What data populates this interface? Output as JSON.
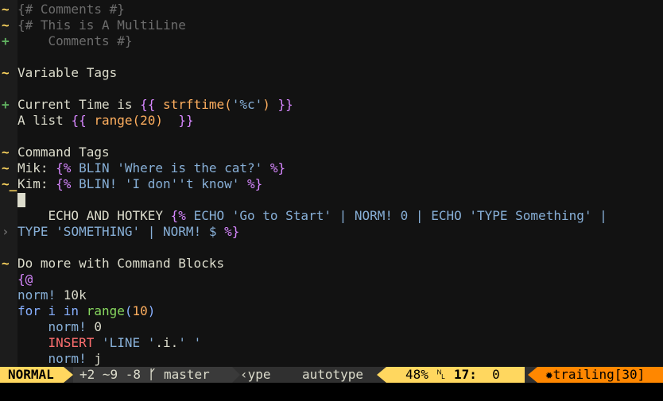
{
  "lines": [
    {
      "sign": "~",
      "sign_type": "mod",
      "parts": [
        {
          "t": "{# Comments #}",
          "c": "comment"
        }
      ]
    },
    {
      "sign": "~",
      "sign_type": "mod",
      "parts": [
        {
          "t": "{# This is A MultiLine",
          "c": "comment"
        }
      ]
    },
    {
      "sign": "+",
      "sign_type": "add",
      "parts": [
        {
          "t": "    Comments #}",
          "c": "comment"
        }
      ]
    },
    {
      "sign": "",
      "sign_type": "",
      "parts": []
    },
    {
      "sign": "~",
      "sign_type": "mod",
      "parts": [
        {
          "t": "Variable Tags",
          "c": "text"
        }
      ]
    },
    {
      "sign": "",
      "sign_type": "",
      "parts": []
    },
    {
      "sign": "+",
      "sign_type": "add",
      "parts": [
        {
          "t": "Current Time is ",
          "c": "text"
        },
        {
          "t": "{{ ",
          "c": "brace"
        },
        {
          "t": "strftime(",
          "c": "func"
        },
        {
          "t": "'%c'",
          "c": "str"
        },
        {
          "t": ") ",
          "c": "func"
        },
        {
          "t": "}}",
          "c": "brace"
        }
      ]
    },
    {
      "sign": "",
      "sign_type": "",
      "parts": [
        {
          "t": "A list ",
          "c": "text"
        },
        {
          "t": "{{ ",
          "c": "brace"
        },
        {
          "t": "range(20)  ",
          "c": "func"
        },
        {
          "t": "}}",
          "c": "brace"
        }
      ]
    },
    {
      "sign": "",
      "sign_type": "",
      "parts": []
    },
    {
      "sign": "~",
      "sign_type": "mod",
      "parts": [
        {
          "t": "Command Tags",
          "c": "text"
        }
      ]
    },
    {
      "sign": "~",
      "sign_type": "mod",
      "parts": [
        {
          "t": "Mik: ",
          "c": "text"
        },
        {
          "t": "{% ",
          "c": "brace"
        },
        {
          "t": "BLIN ",
          "c": "cmd"
        },
        {
          "t": "'Where is the cat?' ",
          "c": "str"
        },
        {
          "t": "%}",
          "c": "brace"
        }
      ]
    },
    {
      "sign": "~_",
      "sign_type": "mod",
      "parts": [
        {
          "t": "Kim: ",
          "c": "text"
        },
        {
          "t": "{% ",
          "c": "brace"
        },
        {
          "t": "BLIN! ",
          "c": "cmd"
        },
        {
          "t": "'I don''t know' ",
          "c": "str"
        },
        {
          "t": "%}",
          "c": "brace"
        }
      ]
    },
    {
      "sign": "",
      "sign_type": "",
      "cursor": true,
      "parts": []
    },
    {
      "sign": "",
      "sign_type": "",
      "parts": [
        {
          "t": "    ECHO AND HOTKEY ",
          "c": "text"
        },
        {
          "t": "{% ",
          "c": "brace"
        },
        {
          "t": "ECHO ",
          "c": "cmd"
        },
        {
          "t": "'Go to Start' ",
          "c": "str"
        },
        {
          "t": "| NORM! 0 | ECHO ",
          "c": "cmd"
        },
        {
          "t": "'TYPE Something' ",
          "c": "str"
        },
        {
          "t": "|",
          "c": "cmd"
        }
      ]
    },
    {
      "sign": "›",
      "sign_type": "wrap",
      "parts": [
        {
          "t": "TYPE ",
          "c": "cmd"
        },
        {
          "t": "'SOMETHING' ",
          "c": "str"
        },
        {
          "t": "| NORM! $ ",
          "c": "cmd"
        },
        {
          "t": "%}",
          "c": "brace"
        }
      ]
    },
    {
      "sign": "",
      "sign_type": "",
      "parts": []
    },
    {
      "sign": "~",
      "sign_type": "mod",
      "parts": [
        {
          "t": "Do more with Command Blocks",
          "c": "text"
        }
      ]
    },
    {
      "sign": "",
      "sign_type": "",
      "parts": [
        {
          "t": "{@",
          "c": "brace"
        }
      ]
    },
    {
      "sign": "",
      "sign_type": "",
      "parts": [
        {
          "t": "norm! ",
          "c": "cmd"
        },
        {
          "t": "10k",
          "c": "text"
        }
      ]
    },
    {
      "sign": "",
      "sign_type": "",
      "parts": [
        {
          "t": "for i in ",
          "c": "kw"
        },
        {
          "t": "range",
          "c": "pyfunc"
        },
        {
          "t": "(",
          "c": "kw"
        },
        {
          "t": "10",
          "c": "num"
        },
        {
          "t": ")",
          "c": "kw"
        }
      ]
    },
    {
      "sign": "",
      "sign_type": "",
      "parts": [
        {
          "t": "    norm! ",
          "c": "cmd"
        },
        {
          "t": "0",
          "c": "text"
        }
      ]
    },
    {
      "sign": "",
      "sign_type": "",
      "parts": [
        {
          "t": "    INSERT ",
          "c": "ins"
        },
        {
          "t": "'LINE '",
          "c": "str"
        },
        {
          "t": ".i.",
          "c": "text"
        },
        {
          "t": "' '",
          "c": "str"
        }
      ]
    },
    {
      "sign": "",
      "sign_type": "",
      "parts": [
        {
          "t": "    norm! ",
          "c": "cmd"
        },
        {
          "t": "j",
          "c": "text"
        }
      ]
    }
  ],
  "statusline": {
    "mode": "NORMAL",
    "git_changes": "+2 ~9 -8",
    "branch_icon": "ᚴ",
    "branch": "master",
    "file": "‹ype",
    "filetype": "autotype",
    "percent": "48%",
    "line_icon": "␤",
    "line": "17:",
    "col": "0",
    "warn_icon": "✹",
    "warning": "trailing[30]"
  }
}
